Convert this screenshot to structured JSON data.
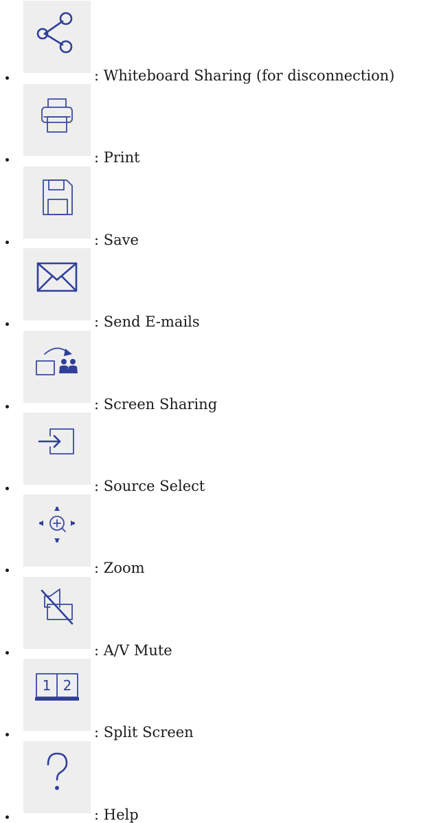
{
  "items": [
    {
      "icon": "share-icon",
      "label": ": Whiteboard Sharing (for disconnection)"
    },
    {
      "icon": "print-icon",
      "label": ": Print"
    },
    {
      "icon": "save-icon",
      "label": ": Save"
    },
    {
      "icon": "mail-icon",
      "label": ": Send E-mails"
    },
    {
      "icon": "screen-sharing-icon",
      "label": ": Screen Sharing"
    },
    {
      "icon": "source-select-icon",
      "label": ": Source Select"
    },
    {
      "icon": "zoom-icon",
      "label": ": Zoom"
    },
    {
      "icon": "av-mute-icon",
      "label": ": A/V Mute"
    },
    {
      "icon": "split-screen-icon",
      "label": ": Split Screen",
      "split_numbers": [
        "1",
        "2"
      ]
    },
    {
      "icon": "help-icon",
      "label": ": Help"
    }
  ],
  "colors": {
    "icon_stroke": "#2f3f9a",
    "tile_background": "#eeeeee",
    "text": "#1a1a1a"
  }
}
